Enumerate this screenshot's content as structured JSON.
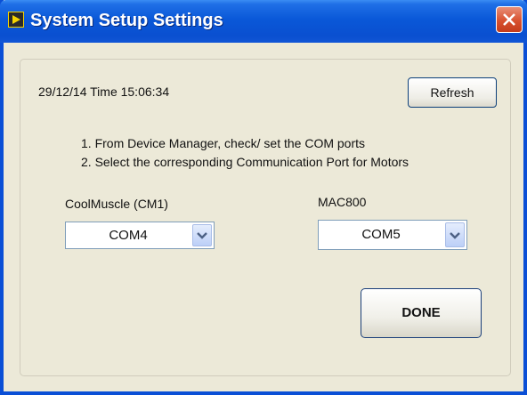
{
  "window": {
    "title": "System Setup Settings"
  },
  "datetime": "29/12/14 Time 15:06:34",
  "refresh_label": "Refresh",
  "instructions": [
    "1. From Device Manager, check/ set the COM ports",
    "2. Select the corresponding Communication Port for Motors"
  ],
  "ports": {
    "cm1": {
      "label": "CoolMuscle (CM1)",
      "value": "COM4"
    },
    "mac800": {
      "label": "MAC800",
      "value": "COM5"
    }
  },
  "done_label": "DONE",
  "colors": {
    "titlebar": "#0a58d8",
    "close": "#d8512f",
    "face": "#ece9d8"
  },
  "icons": [
    "app-icon",
    "close-icon",
    "chevron-down-icon"
  ]
}
